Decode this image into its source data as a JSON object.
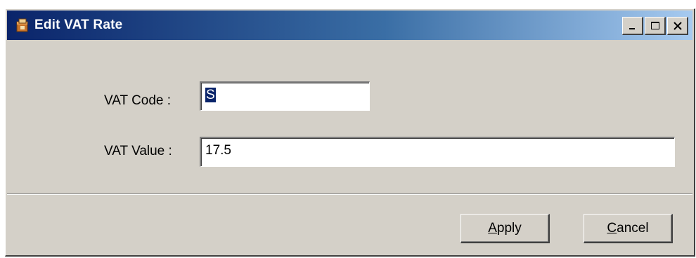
{
  "window": {
    "title": "Edit VAT Rate",
    "controls": {
      "minimize_icon": "minimize-icon",
      "maximize_icon": "maximize-icon",
      "close_icon": "close-icon"
    }
  },
  "form": {
    "vat_code": {
      "label": "VAT Code :",
      "value": "S"
    },
    "vat_value": {
      "label": "VAT Value :",
      "value": "17.5"
    }
  },
  "buttons": {
    "apply": {
      "mnemonic": "A",
      "rest": "pply"
    },
    "cancel": {
      "mnemonic": "C",
      "rest": "ancel"
    }
  },
  "colors": {
    "title_start": "#0a246a",
    "title_end": "#a6caf0",
    "face": "#d4d0c8",
    "selection": "#0a246a"
  }
}
